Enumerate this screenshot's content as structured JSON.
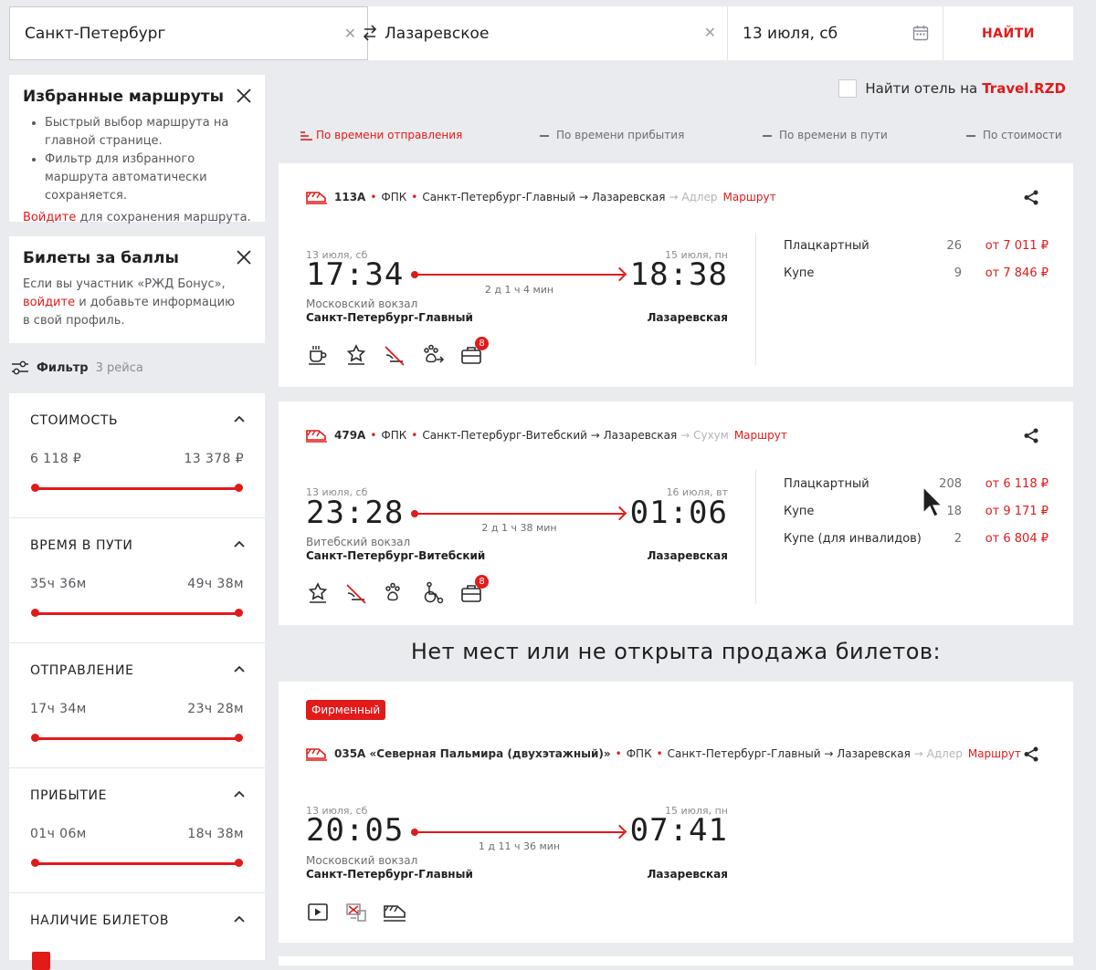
{
  "search": {
    "from": "Санкт-Петербург",
    "to": "Лазаревское",
    "date": "13 июля, сб",
    "find_label": "НАЙТИ"
  },
  "favorites": {
    "title": "Избранные маршруты",
    "items": [
      "Быстрый выбор маршрута на главной странице.",
      "Фильтр для избранного маршрута автоматически сохраняется."
    ],
    "login_link": "Войдите",
    "login_text": " для сохранения маршрута."
  },
  "bonus": {
    "title": "Билеты за баллы",
    "text1": "Если вы участник «РЖД Бонус»,",
    "login_link": "войдите",
    "text2": " и добавьте информацию",
    "text3": "в свой профиль."
  },
  "filter": {
    "label": "Фильтр",
    "count": "3 рейса",
    "blocks": [
      {
        "title": "СТОИМОСТЬ",
        "min": "6 118 ₽",
        "max": "13 378 ₽"
      },
      {
        "title": "ВРЕМЯ В ПУТИ",
        "min": "35ч 36м",
        "max": "49ч 38м"
      },
      {
        "title": "ОТПРАВЛЕНИЕ",
        "min": "17ч 34м",
        "max": "23ч 28м"
      },
      {
        "title": "ПРИБЫТИЕ",
        "min": "01ч 06м",
        "max": "18ч 38м"
      },
      {
        "title": "НАЛИЧИЕ БИЛЕТОВ"
      }
    ]
  },
  "hotel": {
    "text": "Найти отель на",
    "link": "Travel.RZD"
  },
  "sort": {
    "departure": "По времени отправления",
    "arrival": "По времени прибытия",
    "travel": "По времени в пути",
    "cost": "По стоимости"
  },
  "trains": [
    {
      "number": "113А",
      "carrier": "ФПК",
      "from_to": "Санкт-Петербург-Главный → Лазаревская",
      "dest": "→ Адлер",
      "route": "Маршрут",
      "dep_date": "13 июля, сб",
      "dep_time": "17:34",
      "arr_date": "15 июля, пн",
      "arr_time": "18:38",
      "duration": "2 д 1 ч 4 мин",
      "dep_station_sub": "Московский вокзал",
      "dep_station": "Санкт-Петербург-Главный",
      "arr_station": "Лазаревская",
      "badge": "8",
      "prices": [
        {
          "cls": "Плацкартный",
          "count": "26",
          "price": "от 7 011 ₽"
        },
        {
          "cls": "Купе",
          "count": "9",
          "price": "от 7 846 ₽"
        }
      ]
    },
    {
      "number": "479А",
      "carrier": "ФПК",
      "from_to": "Санкт-Петербург-Витебский → Лазаревская",
      "dest": "→ Сухум",
      "route": "Маршрут",
      "dep_date": "13 июля, сб",
      "dep_time": "23:28",
      "arr_date": "16 июля, вт",
      "arr_time": "01:06",
      "duration": "2 д 1 ч 38 мин",
      "dep_station_sub": "Витебский вокзал",
      "dep_station": "Санкт-Петербург-Витебский",
      "arr_station": "Лазаревская",
      "badge": "8",
      "prices": [
        {
          "cls": "Плацкартный",
          "count": "208",
          "price": "от 6 118 ₽"
        },
        {
          "cls": "Купе",
          "count": "18",
          "price": "от 9 171 ₽"
        },
        {
          "cls": "Купе (для инвалидов)",
          "count": "2",
          "price": "от 6 804 ₽"
        }
      ]
    },
    {
      "tag": "Фирменный",
      "number": "035А «Северная Пальмира (двухэтажный)»",
      "carrier": "ФПК",
      "from_to": "Санкт-Петербург-Главный → Лазаревская",
      "dest": "→ Адлер",
      "route": "Маршрут",
      "dep_date": "13 июля, сб",
      "dep_time": "20:05",
      "arr_date": "15 июля, пн",
      "arr_time": "07:41",
      "duration": "1 д 11 ч 36 мин",
      "dep_station_sub": "Московский вокзал",
      "dep_station": "Санкт-Петербург-Главный",
      "arr_station": "Лазаревская"
    }
  ],
  "no_seats": "Нет мест или не открыта продажа билетов:"
}
